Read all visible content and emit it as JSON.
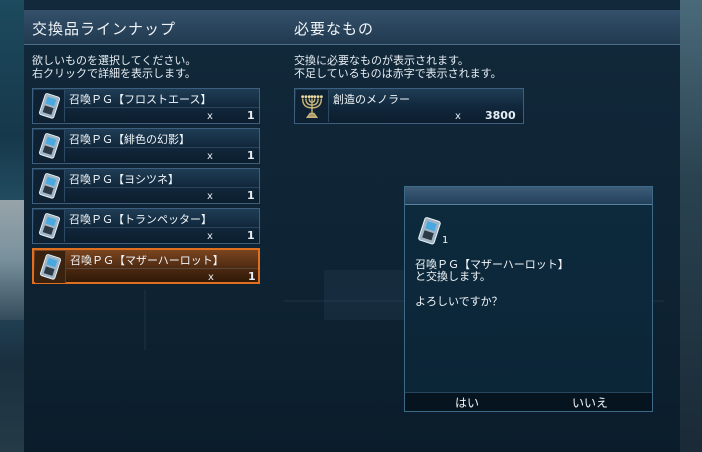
{
  "left_panel": {
    "title": "交換品ラインナップ",
    "instructions": [
      "欲しいものを選択してください。",
      "右クリックで詳細を表示します。"
    ],
    "items": [
      {
        "name": "召喚ＰＧ【フロストエース】",
        "mult": "x",
        "qty": "1",
        "selected": false
      },
      {
        "name": "召喚ＰＧ【緋色の幻影】",
        "mult": "x",
        "qty": "1",
        "selected": false
      },
      {
        "name": "召喚ＰＧ【ヨシツネ】",
        "mult": "x",
        "qty": "1",
        "selected": false
      },
      {
        "name": "召喚ＰＧ【トランペッター】",
        "mult": "x",
        "qty": "1",
        "selected": false
      },
      {
        "name": "召喚ＰＧ【マザーハーロット】",
        "mult": "x",
        "qty": "1",
        "selected": true
      }
    ]
  },
  "right_panel": {
    "title": "必要なもの",
    "instructions": [
      "交換に必要なものが表示されます。",
      "不足しているものは赤字で表示されます。"
    ],
    "required": {
      "name": "創造のメノラー",
      "mult": "x",
      "qty": "3800",
      "icon": "menorah-icon"
    }
  },
  "dialog": {
    "count": "1",
    "message_line1": "召喚ＰＧ【マザーハーロット】",
    "message_line2": "と交換します。",
    "ask": "よろしいですか？",
    "yes_label": "はい",
    "no_label": "いいえ"
  },
  "colors": {
    "panel_bg": "#0e2333",
    "header_bg": "#2a465e",
    "selected_border": "#e07020",
    "text": "#f2f6fa"
  }
}
